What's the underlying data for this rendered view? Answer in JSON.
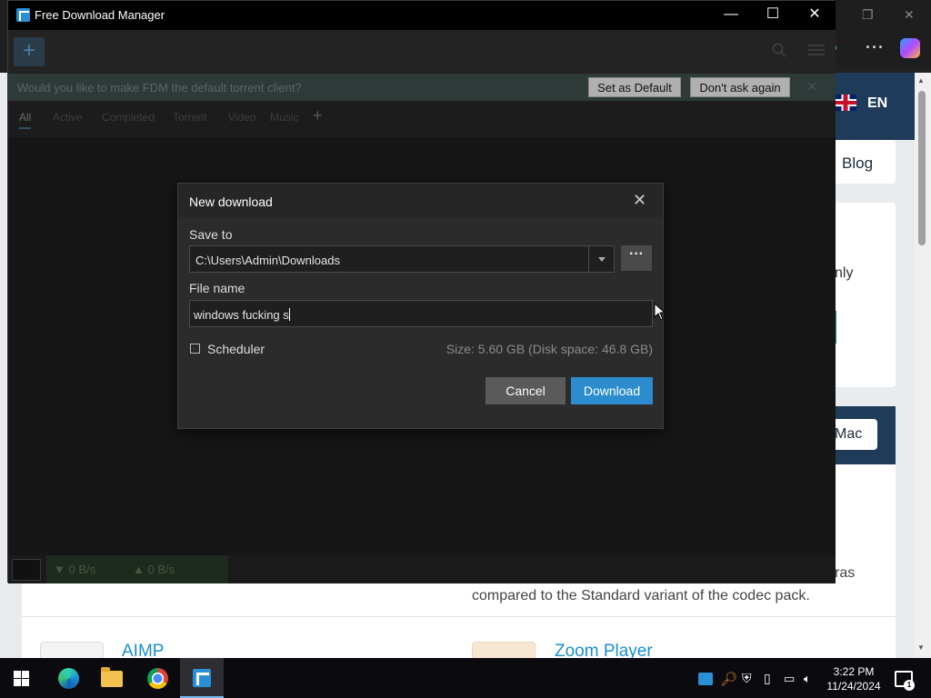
{
  "window": {
    "title": "Free Download Manager"
  },
  "notification": {
    "text": "Would you like to make FDM the default torrent client?",
    "set_default": "Set as Default",
    "dont_ask": "Don't ask again"
  },
  "tabs": [
    "All",
    "Active",
    "Completed",
    "Torrent",
    "Video",
    "Music"
  ],
  "dialog": {
    "title": "New download",
    "save_to_label": "Save to",
    "save_to_value": "C:\\Users\\Admin\\Downloads",
    "browse": "···",
    "file_name_label": "File name",
    "file_name_value": "windows fucking s",
    "scheduler_label": "Scheduler",
    "size_info": "Size: 5.60 GB (Disk space: 46.8 GB)",
    "cancel": "Cancel",
    "download": "Download"
  },
  "status": {
    "down_speed": "▼ 0 B/s",
    "up_speed": "▲ 0 B/s"
  },
  "website": {
    "lang": "EN",
    "blog": "Blog",
    "card_text": "nly",
    "mac": "Mac",
    "para_tail": "ras",
    "para_line": "compared to the Standard variant of the codec pack.",
    "apps": [
      "AIMP",
      "Zoom Player"
    ]
  },
  "taskbar": {
    "time": "3:22 PM",
    "date": "11/24/2024",
    "notif_count": "1"
  }
}
